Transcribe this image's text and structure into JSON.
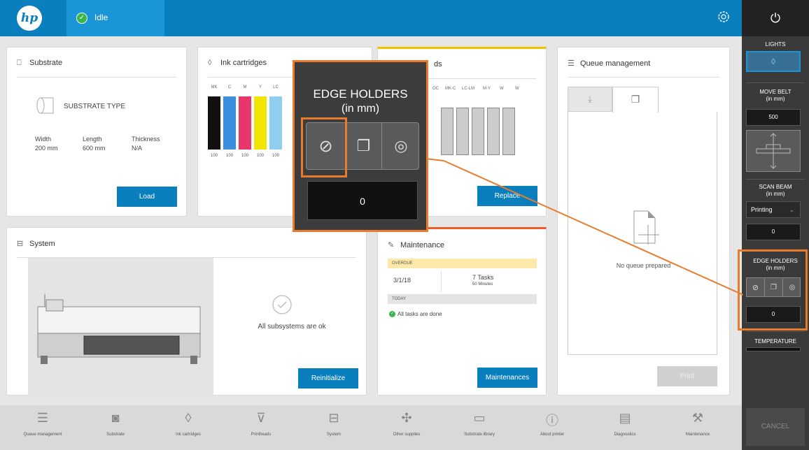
{
  "header": {
    "status": "Idle",
    "logo": "hp"
  },
  "substrate": {
    "title": "Substrate",
    "type_label": "SUBSTRATE TYPE",
    "width_label": "Width",
    "width": "200 mm",
    "length_label": "Length",
    "length": "600 mm",
    "thickness_label": "Thickness",
    "thickness": "N/A",
    "button": "Load"
  },
  "inks": {
    "title": "Ink cartridges",
    "cartridges": [
      {
        "label": "MK",
        "color": "#111111",
        "level": "100"
      },
      {
        "label": "C",
        "color": "#3b8fe0",
        "level": "100"
      },
      {
        "label": "M",
        "color": "#e8356a",
        "level": "100"
      },
      {
        "label": "Y",
        "color": "#f2e600",
        "level": "100"
      },
      {
        "label": "LC",
        "color": "#8ecff0",
        "level": "100"
      }
    ]
  },
  "printheads": {
    "title_tail": "ds",
    "labels": [
      "OC",
      "MK-C",
      "LC-LM",
      "M-Y",
      "W",
      "W"
    ],
    "button": "Replace"
  },
  "queue": {
    "title": "Queue management",
    "empty": "No queue prepared",
    "button": "Print"
  },
  "system": {
    "title": "System",
    "status": "All subsystems are ok",
    "button": "Reinitialize"
  },
  "maintenance": {
    "title": "Maintenance",
    "overdue": "OVERDUE",
    "date": "3/1/18",
    "tasks": "7 Tasks",
    "minutes": "50 Minutes",
    "today": "TODAY",
    "done": "All tasks are done",
    "button": "Maintenances"
  },
  "magnifier": {
    "title1": "EDGE HOLDERS",
    "title2": "(in mm)",
    "value": "0"
  },
  "right_panel": {
    "lights": "LIGHTS",
    "move_belt": "MOVE BELT",
    "move_unit": "(in mm)",
    "move_value": "500",
    "scan_beam": "SCAN BEAM",
    "scan_unit": "(in mm)",
    "scan_mode": "Printing",
    "scan_value": "0",
    "edge": "EDGE HOLDERS",
    "edge_unit": "(in mm)",
    "edge_value": "0",
    "temperature": "TEMPERATURE",
    "cancel": "CANCEL"
  },
  "bottom_nav": [
    {
      "label": "Queue management",
      "icon": "list-icon"
    },
    {
      "label": "Substrate",
      "icon": "substrate-icon"
    },
    {
      "label": "Ink cartridges",
      "icon": "drop-icon"
    },
    {
      "label": "Printheads",
      "icon": "printhead-icon"
    },
    {
      "label": "System",
      "icon": "printer-icon"
    },
    {
      "label": "Other supplies",
      "icon": "supplies-icon"
    },
    {
      "label": "Substrate library",
      "icon": "folder-icon"
    },
    {
      "label": "About printer",
      "icon": "info-icon"
    },
    {
      "label": "Diagnostics",
      "icon": "clipboard-icon"
    },
    {
      "label": "Maintenance",
      "icon": "wrench-icon"
    }
  ]
}
